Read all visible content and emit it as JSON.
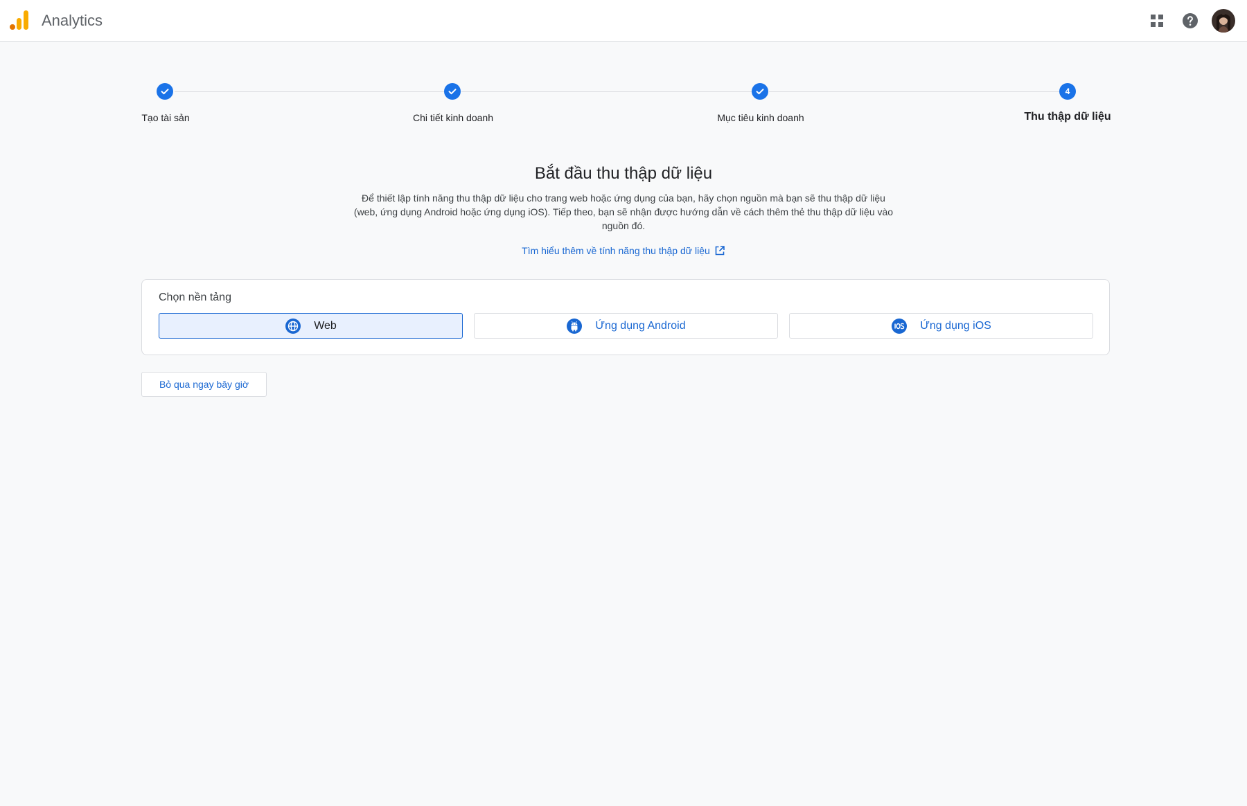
{
  "header": {
    "app_name": "Analytics",
    "icons": [
      "analytics-logo",
      "apps-grid-icon",
      "help-icon",
      "avatar"
    ]
  },
  "stepper": {
    "steps": [
      {
        "label": "Tạo tài sản",
        "state": "done"
      },
      {
        "label": "Chi tiết kinh doanh",
        "state": "done"
      },
      {
        "label": "Mục tiêu kinh doanh",
        "state": "done"
      },
      {
        "label": "Thu thập dữ liệu",
        "state": "active",
        "number": "4"
      }
    ]
  },
  "main": {
    "title": "Bắt đầu thu thập dữ liệu",
    "description": "Để thiết lập tính năng thu thập dữ liệu cho trang web hoặc ứng dụng của bạn, hãy chọn nguồn mà bạn sẽ thu thập dữ liệu (web, ứng dụng Android hoặc ứng dụng iOS). Tiếp theo, bạn sẽ nhận được hướng dẫn về cách thêm thẻ thu thập dữ liệu vào nguồn đó.",
    "learn_more_link": "Tìm hiểu thêm về tính năng thu thập dữ liệu"
  },
  "platform": {
    "label": "Chọn nền tảng",
    "options": [
      {
        "label": "Web",
        "icon": "globe-icon",
        "selected": true
      },
      {
        "label": "Ứng dụng Android",
        "icon": "android-icon",
        "selected": false
      },
      {
        "label": "Ứng dụng iOS",
        "icon": "ios-icon",
        "selected": false
      }
    ]
  },
  "skip_button": "Bỏ qua ngay bây giờ",
  "colors": {
    "accent": "#1a73e8",
    "link": "#1967d2",
    "selected_bg": "#e8f0fe",
    "logo_orange": "#f9ab00",
    "logo_dark_orange": "#e37400"
  }
}
